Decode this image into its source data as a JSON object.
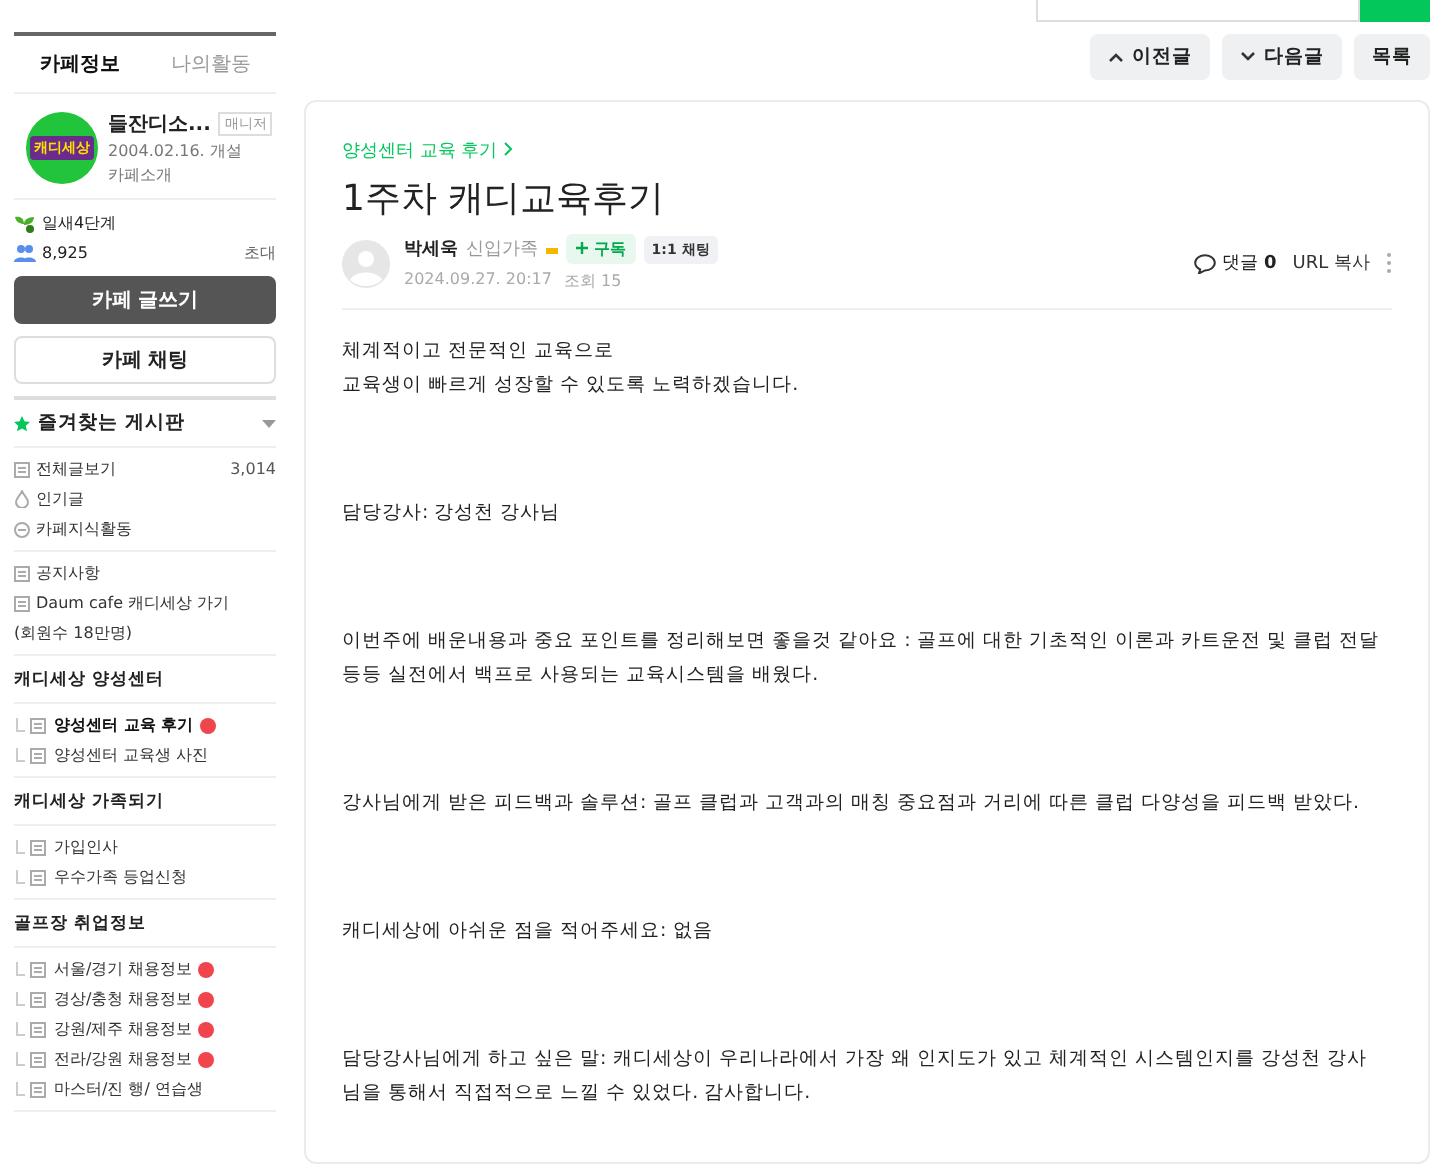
{
  "top_nav": {
    "buttons": [
      {
        "kind": "prev",
        "label": "이전글"
      },
      {
        "kind": "next",
        "label": "다음글"
      },
      {
        "kind": "plain",
        "label": "목록"
      }
    ]
  },
  "sidebar": {
    "tabs": [
      {
        "label": "카페정보",
        "selected": true
      },
      {
        "label": "나의활동",
        "selected": false
      }
    ],
    "cafe": {
      "logo_text": "캐디세상",
      "name": "들잔디소...",
      "role": "매니저",
      "founded": "2004.02.16. 개설",
      "intro": "카페소개",
      "level": "일새4단계",
      "members": "8,925",
      "invite": "초대"
    },
    "write_button": "카페 글쓰기",
    "chat_button": "카페 채팅",
    "favorites": "즐겨찾는 게시판",
    "sections": [
      {
        "items": [
          {
            "kind": "all",
            "label": "전체글보기",
            "count": "3,014"
          },
          {
            "kind": "popular",
            "label": "인기글"
          },
          {
            "kind": "knowledge",
            "label": "카페지식활동"
          }
        ]
      },
      {
        "items": [
          {
            "kind": "board",
            "label": "공지사항"
          },
          {
            "kind": "board",
            "label": "Daum cafe 캐디세상 가기"
          },
          {
            "kind": "note",
            "label": "(회원수 18만명)"
          }
        ]
      },
      {
        "title": "캐디세상 양성센터",
        "items": [
          {
            "kind": "sub",
            "label": "양성센터 교육 후기",
            "selected": true,
            "new": true
          },
          {
            "kind": "sub",
            "label": "양성센터 교육생 사진",
            "selected": false,
            "new": false
          }
        ]
      },
      {
        "title": "캐디세상 가족되기",
        "items": [
          {
            "kind": "sub",
            "label": "가입인사",
            "selected": false,
            "new": false
          },
          {
            "kind": "sub",
            "label": "우수가족 등업신청",
            "selected": false,
            "new": false
          }
        ]
      },
      {
        "title": "골프장 취업정보",
        "items": [
          {
            "kind": "sub",
            "label": "서울/경기 채용정보",
            "selected": false,
            "new": true
          },
          {
            "kind": "sub",
            "label": "경상/충청 채용정보",
            "selected": false,
            "new": true
          },
          {
            "kind": "sub",
            "label": "강원/제주 채용정보",
            "selected": false,
            "new": true
          },
          {
            "kind": "sub",
            "label": "전라/강원 채용정보",
            "selected": false,
            "new": true
          },
          {
            "kind": "sub",
            "label": "마스터/진 행/ 연습생",
            "selected": false,
            "new": false
          }
        ]
      }
    ]
  },
  "article": {
    "breadcrumb": "양성센터 교육 후기",
    "title": "1주차 캐디교육후기",
    "author": "박세욱",
    "author_level": "신입가족",
    "subscribe": "구독",
    "chat": "1:1 채팅",
    "date": "2024.09.27. 20:17",
    "views": "조회 15",
    "comments_label": "댓글",
    "comments": "0",
    "url_copy": "URL 복사",
    "paragraphs": [
      {
        "lines": [
          "체계적이고 전문적인 교육으로",
          "교육생이 빠르게 성장할 수 있도록 노력하겠습니다."
        ]
      },
      {
        "lines": [
          "담당강사: 강성천 강사님"
        ]
      },
      {
        "lines": [
          "이번주에 배운내용과 중요 포인트를 정리해보면 좋을것 같아요 : 골프에 대한 기초적인 이론과 카트운전 및 클럽 전달 등등 실전에서 백프로 사용되는 교육시스템을 배웠다."
        ]
      },
      {
        "lines": [
          "강사님에게 받은 피드백과 솔루션: 골프 클럽과 고객과의 매칭 중요점과 거리에 따른 클럽 다양성을 피드백 받았다."
        ]
      },
      {
        "lines": [
          "캐디세상에 아쉬운 점을 적어주세요: 없음"
        ]
      },
      {
        "lines": [
          "담당강사님에게 하고 싶은 말: 캐디세상이 우리나라에서 가장 왜 인지도가 있고 체계적인 시스템인지를 강성천 강사님을 통해서 직접적으로 느낄 수 있었다. 감사합니다."
        ]
      }
    ]
  }
}
